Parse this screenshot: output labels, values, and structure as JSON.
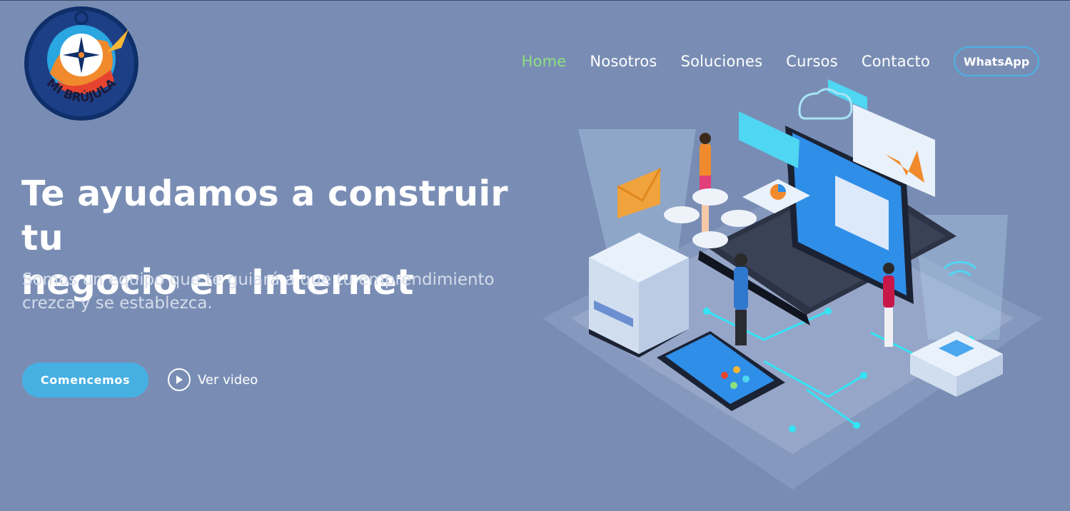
{
  "brand": {
    "logo_text": "MI BRÚJULA",
    "logo_name": "compass-logo"
  },
  "nav": {
    "items": [
      {
        "label": "Home",
        "active": true
      },
      {
        "label": "Nosotros",
        "active": false
      },
      {
        "label": "Soluciones",
        "active": false
      },
      {
        "label": "Cursos",
        "active": false
      },
      {
        "label": "Contacto",
        "active": false
      }
    ],
    "whatsapp_label": "WhatsApp"
  },
  "hero": {
    "title_line1": "Te ayudamos a construir tu",
    "title_line2": "negocio en Internet",
    "subtitle_line1": "Somos un equipo que te guiará a que tu emprendimiento",
    "subtitle_line2": "crezca y se establezca.",
    "cta_label": "Comencemos",
    "video_label": "Ver video",
    "video_icon": "play-circle-icon"
  },
  "colors": {
    "background": "#798db4",
    "accent": "#47b0e2",
    "active_nav": "#8ee07e"
  }
}
